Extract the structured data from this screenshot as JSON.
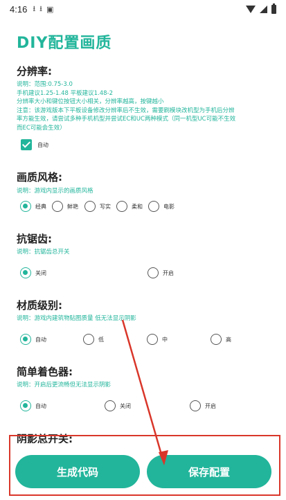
{
  "status_bar": {
    "time": "4:16",
    "icons": [
      "download-icon",
      "download-icon",
      "app-a-icon",
      "wifi-icon",
      "signal-icon",
      "battery-icon"
    ]
  },
  "page_title": "DIY配置画质",
  "resolution": {
    "title": "分辨率:",
    "desc_lines": [
      "说明：范围:0.75-3.0",
      "手机建议1.25-1.48  平板建议1.48-2",
      "分辨率大小和键位按钮大小相关，分辨率越高，按键越小",
      "注意：该游戏版本下平板设备修改分辨率后不生效，需要刷模块改机型为手机后分辨",
      "率方能生效，请尝试多种手机机型并尝试EC和UC两种模式（同一机型UC可能不生效",
      "而EC可能会生效）"
    ],
    "auto_label": "自动",
    "auto_checked": true
  },
  "style": {
    "title": "画质风格:",
    "desc": "说明：游戏内显示的画质风格",
    "options": [
      "经典",
      "鲜艳",
      "写实",
      "柔和",
      "电影"
    ],
    "selected": 0
  },
  "antialias": {
    "title": "抗锯齿:",
    "desc": "说明：抗锯齿总开关",
    "options": [
      "关闭",
      "开启"
    ],
    "selected": 0
  },
  "material": {
    "title": "材质级别:",
    "desc": "说明：游戏内建筑物贴图质量 低无法显示阴影",
    "options": [
      "自动",
      "低",
      "中",
      "高"
    ],
    "selected": 0
  },
  "shader": {
    "title": "简单着色器:",
    "desc": "说明：开启后更流畅但无法显示阴影",
    "options": [
      "自动",
      "关闭",
      "开启"
    ],
    "selected": 0
  },
  "shadow": {
    "title": "阴影总开关:"
  },
  "buttons": {
    "generate": "生成代码",
    "save": "保存配置"
  },
  "colors": {
    "accent": "#22b59b",
    "annotation": "#d9362a"
  }
}
